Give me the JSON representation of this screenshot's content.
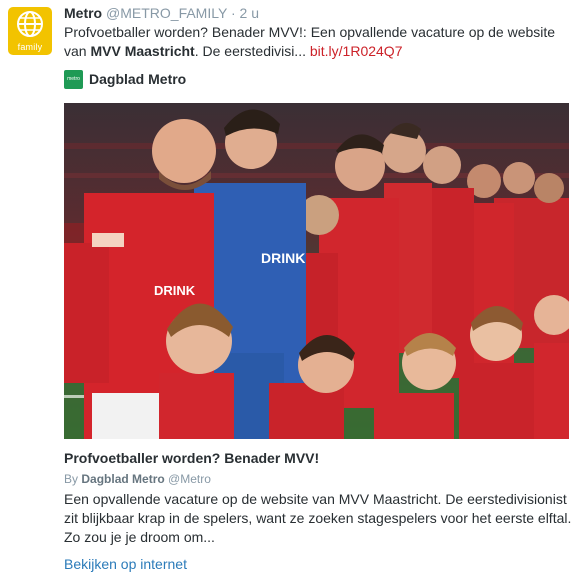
{
  "tweet": {
    "author_name": "Metro",
    "author_handle": "@METRO_FAMILY",
    "separator": "·",
    "time": "2 u",
    "text_line1": "Profvoetballer worden? Benader MVV!: Een opvallende vacature op de website",
    "text_line2_prefix": "van ",
    "text_line2_bold": "MVV Maastricht",
    "text_line2_mid": ". De eerstedivisi... ",
    "link": "bit.ly/1R024Q7",
    "avatar_label": "family",
    "avatar_icon": "globe-icon"
  },
  "source": {
    "logo_text": "metro",
    "name": "Dagblad Metro"
  },
  "card": {
    "image_description_icon": "football-team-photo",
    "title": "Profvoetballer worden? Benader MVV!",
    "by_prefix": "By",
    "by_name": "Dagblad Metro",
    "by_handle": "@Metro",
    "description": "Een opvallende vacature op de website van MVV Maastricht. De eerstedivisionist zit blijkbaar krap in de spelers, want ze zoeken stagespelers voor het eerste elftal. Zo zou je je droom om...",
    "link_label": "Bekijken op internet"
  },
  "colors": {
    "link": "#cc2229",
    "view_link": "#2b7bb9",
    "avatar_bg": "#f2c300",
    "source_logo_bg": "#1f9a55",
    "muted": "#8899a6"
  }
}
